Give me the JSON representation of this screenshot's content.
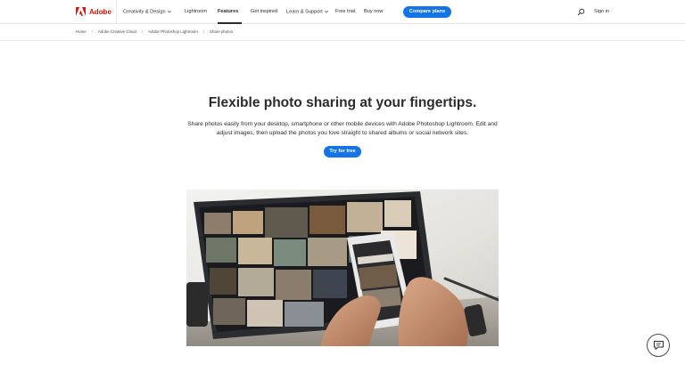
{
  "brand": {
    "name": "Adobe",
    "color": "#eb1000",
    "icon": "adobe-logo-icon"
  },
  "nav": {
    "items": [
      {
        "label": "Creativity & Design",
        "dropdown": true
      },
      {
        "label": "Lightroom",
        "dropdown": false
      },
      {
        "label": "Features",
        "dropdown": false,
        "active": true
      },
      {
        "label": "Get inspired",
        "dropdown": false
      },
      {
        "label": "Learn & Support",
        "dropdown": true
      },
      {
        "label": "Free trial",
        "dropdown": false
      },
      {
        "label": "Buy now",
        "dropdown": false
      }
    ],
    "cta_label": "Compare plans",
    "search_icon": "search-icon",
    "signin_label": "Sign in"
  },
  "breadcrumb": [
    "Home",
    "Adobe Creative Cloud",
    "Adobe Photoshop Lightroom",
    "Share photos"
  ],
  "hero": {
    "title": "Flexible photo sharing at your fingertips.",
    "description": "Share photos easily from your desktop, smartphone or other mobile devices with Adobe Photoshop Lightroom. Edit and adjust images, then upload the photos you love straight to shared albums or social network sites.",
    "cta_label": "Try for free"
  },
  "chat": {
    "icon": "chat-icon"
  },
  "colors": {
    "accent": "#1473e6",
    "text": "#2c2c2c"
  }
}
